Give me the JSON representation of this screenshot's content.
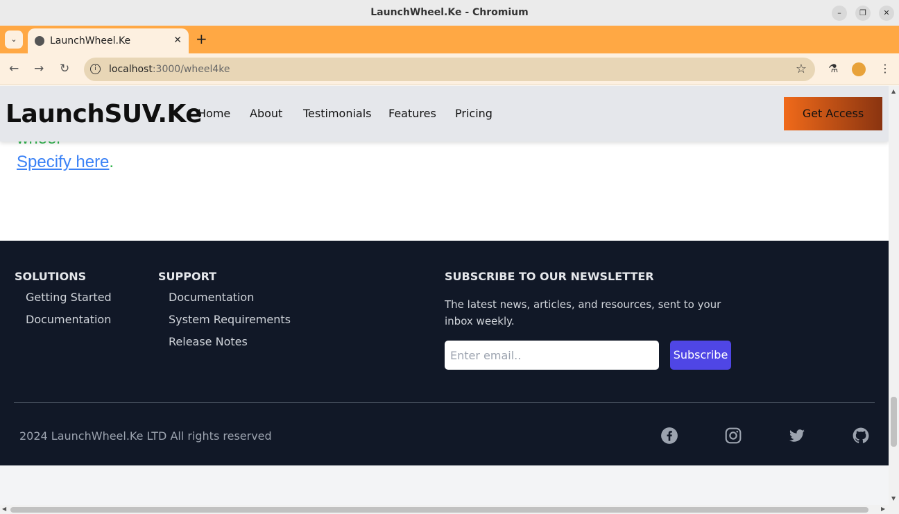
{
  "window": {
    "title": "LaunchWheel.Ke - Chromium"
  },
  "tab": {
    "title": "LaunchWheel.Ke"
  },
  "address_bar": {
    "host": "localhost",
    "path": ":3000/wheel4ke"
  },
  "site_nav": {
    "brand": "LaunchSUV.Ke",
    "links": [
      "Home",
      "About",
      "Testimonials",
      "Features",
      "Pricing"
    ],
    "cta_label": "Get Access"
  },
  "content": {
    "partial_text": "wheel",
    "specify_link": "Specify here",
    "specify_suffix": "."
  },
  "footer": {
    "solutions": {
      "heading": "SOLUTIONS",
      "links": [
        "Getting Started",
        "Documentation"
      ]
    },
    "support": {
      "heading": "SUPPORT",
      "links": [
        "Documentation",
        "System Requirements",
        "Release Notes"
      ]
    },
    "newsletter": {
      "heading": "SUBSCRIBE TO OUR NEWSLETTER",
      "description": "The latest news, articles, and resources, sent to your inbox weekly.",
      "email_placeholder": "Enter email..",
      "button_label": "Subscribe"
    },
    "copyright": "2024 LaunchWheel.Ke LTD All rights reserved",
    "social_icons": [
      "facebook-icon",
      "instagram-icon",
      "twitter-icon",
      "github-icon"
    ]
  },
  "colors": {
    "tab_strip": "#ffa844",
    "footer_bg": "#111827",
    "subscribe_button": "#4f46e5",
    "link_blue": "#3b82f6",
    "accent_green": "#2db34a",
    "cta_gradient_start": "#f06a1a",
    "cta_gradient_end": "#8a3410"
  }
}
